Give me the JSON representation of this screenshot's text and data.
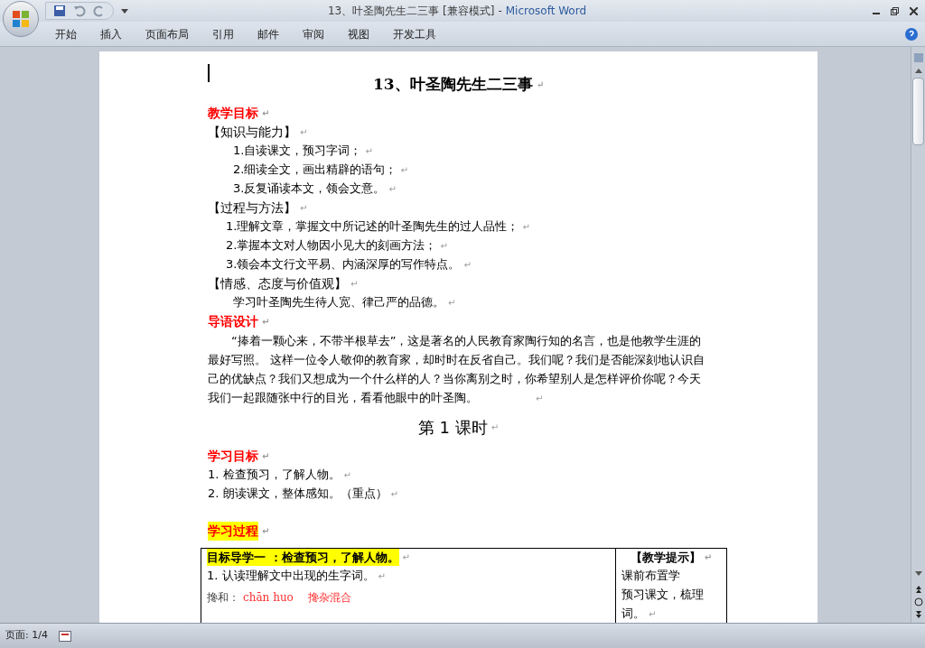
{
  "window": {
    "title": "13、叶圣陶先生二三事 [兼容模式]",
    "separator": "-",
    "app": "Microsoft Word"
  },
  "ribbon_tabs": [
    "开始",
    "插入",
    "页面布局",
    "引用",
    "邮件",
    "审阅",
    "视图",
    "开发工具"
  ],
  "document": [
    {
      "kind": "title",
      "text": "13、叶圣陶先生二三事",
      "mark": "↵"
    },
    {
      "kind": "heading",
      "text": "教学目标",
      "mark": "↵"
    },
    {
      "kind": "section",
      "text": "【知识与能力】",
      "mark": "↵"
    },
    {
      "kind": "deep",
      "text": "1.自读课文，预习字词；",
      "mark": "↵"
    },
    {
      "kind": "deep",
      "text": "2.细读全文，画出精辟的语句；",
      "mark": "↵"
    },
    {
      "kind": "deep",
      "text": "3.反复诵读本文，领会文意。",
      "mark": "↵"
    },
    {
      "kind": "section",
      "text": "【过程与方法】",
      "mark": "↵"
    },
    {
      "kind": "item",
      "text": "1.理解文章，掌握文中所记述的叶圣陶先生的过人品性；",
      "mark": "↵"
    },
    {
      "kind": "item",
      "text": "2.掌握本文对人物因小见大的刻画方法；",
      "mark": "↵"
    },
    {
      "kind": "item",
      "text": "3.领会本文行文平易、内涵深厚的写作特点。",
      "mark": "↵"
    },
    {
      "kind": "section",
      "text": "【情感、态度与价值观】",
      "mark": "↵"
    },
    {
      "kind": "deep",
      "text": "学习叶圣陶先生待人宽、律己严的品德。",
      "mark": "↵"
    },
    {
      "kind": "heading",
      "text": "导语设计",
      "mark": "↵"
    },
    {
      "kind": "para",
      "text": "“捧着一颗心来，不带半根草去”，这是著名的人民教育家陶行知的名言，也是他教学生涯的最好写照。 这样一位令人敬仰的教育家，却时时在反省自己。我们呢？我们是否能深刻地认识自己的优缺点？我们又想成为一个什么样的人？当你离别之时，你希望别人是怎样评价你呢？今天我们一起跟随张中行的目光，看看他眼中的叶圣陶。",
      "mark": "↵"
    },
    {
      "kind": "lesson",
      "text": "第 1 课时",
      "mark": "↵"
    },
    {
      "kind": "heading",
      "text": "学习目标",
      "mark": "↵"
    },
    {
      "kind": "plain",
      "text": "1. 检查预习，了解人物。",
      "mark": "↵"
    },
    {
      "kind": "plain",
      "text": "2. 朗读课文，整体感知。（重点）",
      "mark": "↵"
    },
    {
      "kind": "gap"
    },
    {
      "kind": "highlight",
      "text": "学习过程",
      "mark": "↵"
    }
  ],
  "table": {
    "left": [
      {
        "kind": "highlight",
        "text": "目标导学一 ：检查预习，了解人物。",
        "mark": "↵"
      },
      {
        "kind": "plain",
        "text": "1. 认读理解文中出现的生字词。",
        "mark": "↵"
      },
      {
        "kind": "gloss",
        "term": "搀和：",
        "pinyin": "chān huo",
        "meaning": "搀杂混合"
      }
    ],
    "right": [
      {
        "kind": "tip",
        "text": "【教学提示】",
        "mark": "↵"
      },
      {
        "kind": "plain",
        "text": "课前布置学"
      },
      {
        "kind": "plain",
        "text": "预习课文，梳理"
      },
      {
        "kind": "plain",
        "text": "词。",
        "mark": "↵"
      }
    ]
  },
  "status_bar": {
    "page": "页面: 1/4"
  }
}
